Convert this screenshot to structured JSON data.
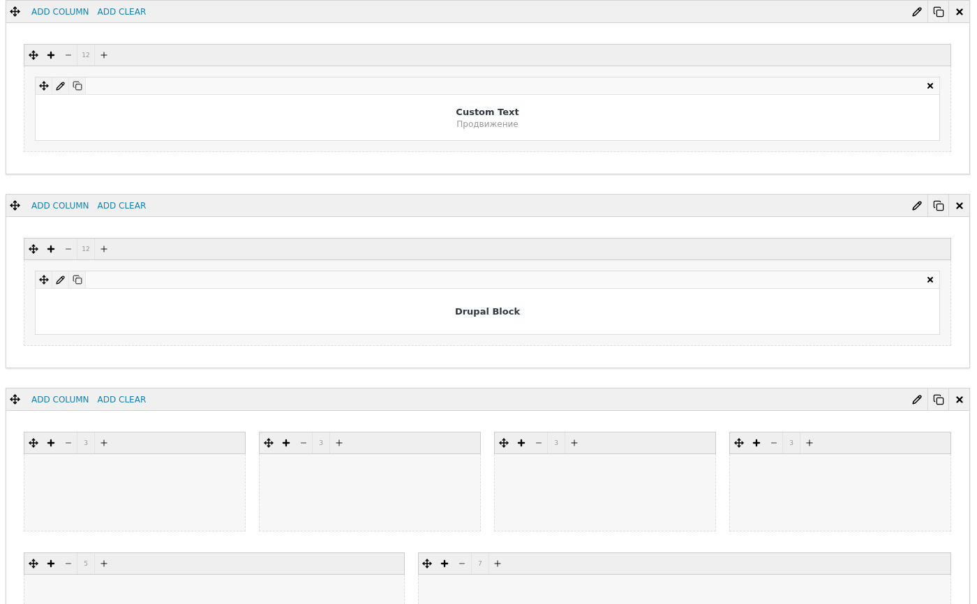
{
  "sections": [
    {
      "actions": [
        "ADD COLUMN",
        "ADD CLEAR"
      ],
      "rows": [
        {
          "columns": [
            {
              "span": "12",
              "blocks": [
                {
                  "title": "Custom Text",
                  "subtitle": "Продвижение"
                }
              ]
            }
          ]
        }
      ]
    },
    {
      "actions": [
        "ADD COLUMN",
        "ADD CLEAR"
      ],
      "rows": [
        {
          "columns": [
            {
              "span": "12",
              "blocks": [
                {
                  "title": "Drupal Block"
                }
              ]
            }
          ]
        }
      ]
    },
    {
      "actions": [
        "ADD COLUMN",
        "ADD CLEAR"
      ],
      "rows": [
        {
          "columns": [
            {
              "span": "3"
            },
            {
              "span": "3"
            },
            {
              "span": "3"
            },
            {
              "span": "3"
            }
          ]
        },
        {
          "columns": [
            {
              "span": "5"
            },
            {
              "span": "7"
            }
          ]
        }
      ]
    }
  ]
}
